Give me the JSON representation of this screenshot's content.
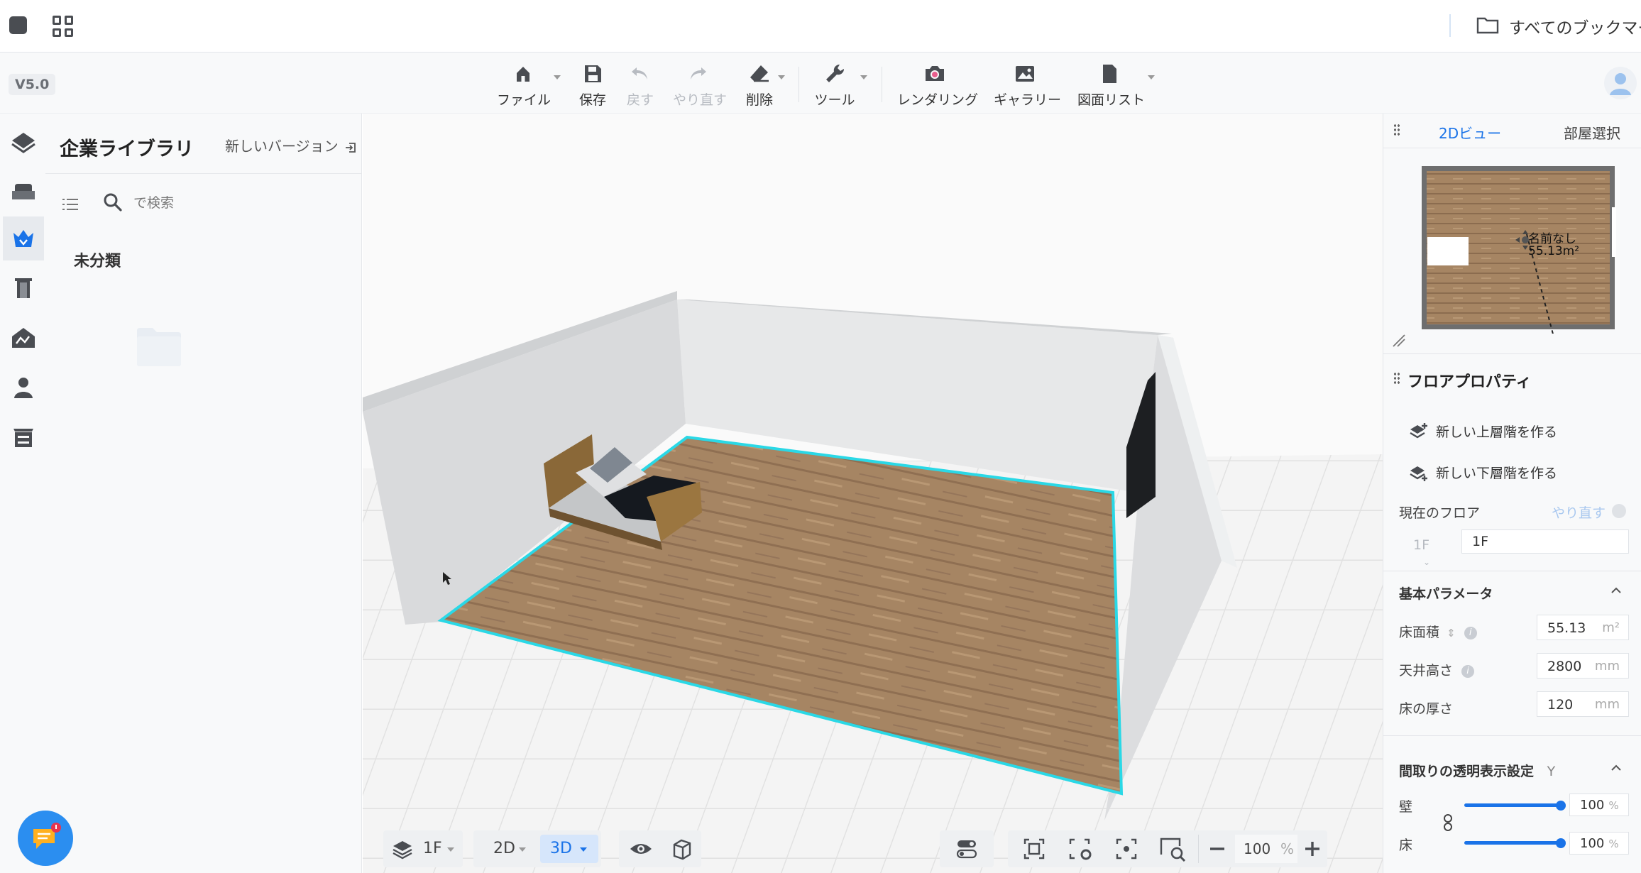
{
  "browser": {
    "bookmarks_label": "すべてのブックマーク"
  },
  "toolbar": {
    "version": "V5.0",
    "file": "ファイル",
    "save": "保存",
    "undo": "戻す",
    "redo": "やり直す",
    "delete": "削除",
    "tools": "ツール",
    "render": "レンダリング",
    "gallery": "ギャラリー",
    "drawing_list": "図面リスト"
  },
  "rail": {
    "icons": [
      "layers-icon",
      "sofa-icon",
      "enterprise-crown-icon",
      "door-icon",
      "terrain-icon",
      "user-icon",
      "cabinet-icon"
    ],
    "active": "enterprise-crown-icon"
  },
  "library": {
    "title": "企業ライブラリ",
    "new_version": "新しいバージョン",
    "search_placeholder": "で検索",
    "category": "未分類"
  },
  "viewport": {
    "mode": "3D"
  },
  "minimap": {
    "room_name": "名前なし",
    "room_area": "55.13m²"
  },
  "right_panel": {
    "tab_2d": "2Dビュー",
    "tab_room": "部屋選択",
    "floor_properties": "フロアプロパティ",
    "new_upper_floor": "新しい上層階を作る",
    "new_lower_floor": "新しい下層階を作る",
    "current_floor_label": "現在のフロア",
    "redo": "やり直す",
    "floor_select": "1F",
    "floor_name": "1F",
    "basic_params_title": "基本パラメータ",
    "area_label": "床面積",
    "area_value": "55.13",
    "area_unit": "m²",
    "ceiling_label": "天井高さ",
    "ceiling_value": "2800",
    "ceiling_unit": "mm",
    "floor_thickness_label": "床の厚さ",
    "floor_thickness_value": "120",
    "floor_thickness_unit": "mm",
    "transparency_title": "間取りの透明表示設定",
    "transparency_hint": "Y",
    "wall_label": "壁",
    "wall_value": "100",
    "floor_label": "床",
    "floor_value": "100",
    "percent": "%",
    "wall_level": 1.0,
    "floor_level": 1.0
  },
  "bottom_bar": {
    "floor": "1F",
    "view_2d": "2D",
    "view_3d": "3D",
    "zoom": "100",
    "zoom_unit": "%"
  },
  "colors": {
    "accent": "#1a73e8",
    "selection_outline": "#2ad8e6",
    "chat_button": "#2b8ef0"
  }
}
